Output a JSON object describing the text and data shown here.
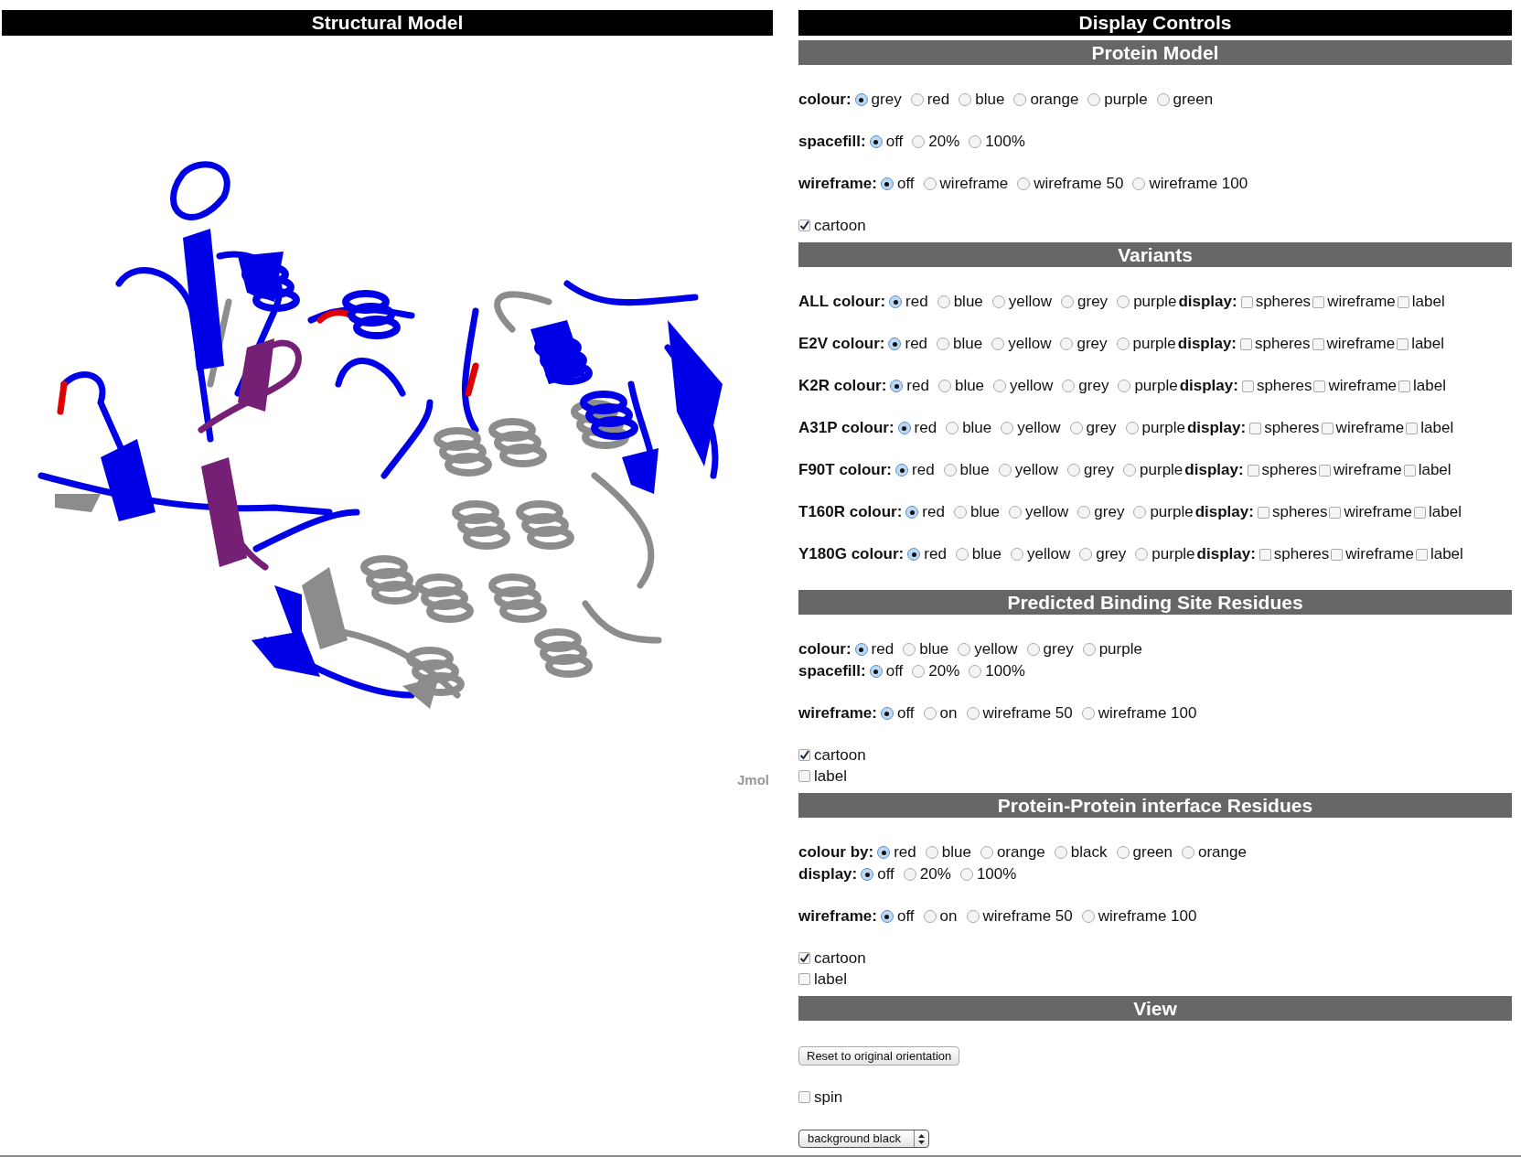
{
  "structural_model": {
    "title": "Structural Model",
    "viewer_label": "Jmol"
  },
  "display_controls": {
    "title": "Display Controls",
    "sections": [
      {
        "title": "Protein Model",
        "groups": [
          [
            {
              "kind": "radio",
              "label": "colour:",
              "options": [
                {
                  "text": "grey",
                  "selected": true
                },
                {
                  "text": "red",
                  "selected": false
                },
                {
                  "text": "blue",
                  "selected": false
                },
                {
                  "text": "orange",
                  "selected": false
                },
                {
                  "text": "purple",
                  "selected": false
                },
                {
                  "text": "green",
                  "selected": false
                }
              ]
            }
          ],
          [
            {
              "kind": "radio",
              "label": "spacefill:",
              "options": [
                {
                  "text": "off",
                  "selected": true
                },
                {
                  "text": "20%",
                  "selected": false
                },
                {
                  "text": "100%",
                  "selected": false
                }
              ]
            }
          ],
          [
            {
              "kind": "radio",
              "label": "wireframe:",
              "options": [
                {
                  "text": "off",
                  "selected": true
                },
                {
                  "text": "wireframe",
                  "selected": false
                },
                {
                  "text": "wireframe 50",
                  "selected": false
                },
                {
                  "text": "wireframe 100",
                  "selected": false
                }
              ]
            }
          ],
          [
            {
              "kind": "checkbox",
              "text": "cartoon",
              "checked": true
            }
          ]
        ]
      },
      {
        "title": "Variants",
        "groups": [
          [
            {
              "kind": "variant",
              "label": "ALL colour:",
              "options": [
                {
                  "text": "red",
                  "selected": true
                },
                {
                  "text": "blue",
                  "selected": false
                },
                {
                  "text": "yellow",
                  "selected": false
                },
                {
                  "text": "grey",
                  "selected": false
                },
                {
                  "text": "purple",
                  "selected": false
                }
              ],
              "display_label": "display:",
              "display_options": [
                {
                  "text": "spheres",
                  "checked": false
                },
                {
                  "text": "wireframe",
                  "checked": false
                },
                {
                  "text": "label",
                  "checked": false
                }
              ]
            }
          ],
          [
            {
              "kind": "variant",
              "label": "E2V colour:",
              "options": [
                {
                  "text": "red",
                  "selected": true
                },
                {
                  "text": "blue",
                  "selected": false
                },
                {
                  "text": "yellow",
                  "selected": false
                },
                {
                  "text": "grey",
                  "selected": false
                },
                {
                  "text": "purple",
                  "selected": false
                }
              ],
              "display_label": "display:",
              "display_options": [
                {
                  "text": "spheres",
                  "checked": false
                },
                {
                  "text": "wireframe",
                  "checked": false
                },
                {
                  "text": "label",
                  "checked": false
                }
              ]
            }
          ],
          [
            {
              "kind": "variant",
              "label": "K2R colour:",
              "options": [
                {
                  "text": "red",
                  "selected": true
                },
                {
                  "text": "blue",
                  "selected": false
                },
                {
                  "text": "yellow",
                  "selected": false
                },
                {
                  "text": "grey",
                  "selected": false
                },
                {
                  "text": "purple",
                  "selected": false
                }
              ],
              "display_label": "display:",
              "display_options": [
                {
                  "text": "spheres",
                  "checked": false
                },
                {
                  "text": "wireframe",
                  "checked": false
                },
                {
                  "text": "label",
                  "checked": false
                }
              ]
            }
          ],
          [
            {
              "kind": "variant",
              "label": "A31P colour:",
              "options": [
                {
                  "text": "red",
                  "selected": true
                },
                {
                  "text": "blue",
                  "selected": false
                },
                {
                  "text": "yellow",
                  "selected": false
                },
                {
                  "text": "grey",
                  "selected": false
                },
                {
                  "text": "purple",
                  "selected": false
                }
              ],
              "display_label": "display:",
              "display_options": [
                {
                  "text": "spheres",
                  "checked": false
                },
                {
                  "text": "wireframe",
                  "checked": false
                },
                {
                  "text": "label",
                  "checked": false
                }
              ]
            }
          ],
          [
            {
              "kind": "variant",
              "label": "F90T colour:",
              "options": [
                {
                  "text": "red",
                  "selected": true
                },
                {
                  "text": "blue",
                  "selected": false
                },
                {
                  "text": "yellow",
                  "selected": false
                },
                {
                  "text": "grey",
                  "selected": false
                },
                {
                  "text": "purple",
                  "selected": false
                }
              ],
              "display_label": "display:",
              "display_options": [
                {
                  "text": "spheres",
                  "checked": false
                },
                {
                  "text": "wireframe",
                  "checked": false
                },
                {
                  "text": "label",
                  "checked": false
                }
              ]
            }
          ],
          [
            {
              "kind": "variant",
              "label": "T160R colour:",
              "options": [
                {
                  "text": "red",
                  "selected": true
                },
                {
                  "text": "blue",
                  "selected": false
                },
                {
                  "text": "yellow",
                  "selected": false
                },
                {
                  "text": "grey",
                  "selected": false
                },
                {
                  "text": "purple",
                  "selected": false
                }
              ],
              "display_label": "display:",
              "display_options": [
                {
                  "text": "spheres",
                  "checked": false
                },
                {
                  "text": "wireframe",
                  "checked": false
                },
                {
                  "text": "label",
                  "checked": false
                }
              ]
            }
          ],
          [
            {
              "kind": "variant",
              "label": "Y180G colour:",
              "options": [
                {
                  "text": "red",
                  "selected": true
                },
                {
                  "text": "blue",
                  "selected": false
                },
                {
                  "text": "yellow",
                  "selected": false
                },
                {
                  "text": "grey",
                  "selected": false
                },
                {
                  "text": "purple",
                  "selected": false
                }
              ],
              "display_label": "display:",
              "display_options": [
                {
                  "text": "spheres",
                  "checked": false
                },
                {
                  "text": "wireframe",
                  "checked": false
                },
                {
                  "text": "label",
                  "checked": false
                }
              ]
            }
          ]
        ]
      },
      {
        "title": "Predicted Binding Site Residues",
        "groups": [
          [
            {
              "kind": "radio",
              "label": "colour:",
              "options": [
                {
                  "text": "red",
                  "selected": true
                },
                {
                  "text": "blue",
                  "selected": false
                },
                {
                  "text": "yellow",
                  "selected": false
                },
                {
                  "text": "grey",
                  "selected": false
                },
                {
                  "text": "purple",
                  "selected": false
                }
              ]
            },
            {
              "kind": "radio",
              "label": "spacefill:",
              "options": [
                {
                  "text": "off",
                  "selected": true
                },
                {
                  "text": "20%",
                  "selected": false
                },
                {
                  "text": "100%",
                  "selected": false
                }
              ]
            }
          ],
          [
            {
              "kind": "radio",
              "label": "wireframe:",
              "options": [
                {
                  "text": "off",
                  "selected": true
                },
                {
                  "text": "on",
                  "selected": false
                },
                {
                  "text": "wireframe 50",
                  "selected": false
                },
                {
                  "text": "wireframe 100",
                  "selected": false
                }
              ]
            }
          ],
          [
            {
              "kind": "checkbox",
              "text": "cartoon",
              "checked": true
            },
            {
              "kind": "checkbox",
              "text": "label",
              "checked": false
            }
          ]
        ]
      },
      {
        "title": "Protein-Protein interface Residues",
        "groups": [
          [
            {
              "kind": "radio",
              "label": "colour by:",
              "options": [
                {
                  "text": "red",
                  "selected": true
                },
                {
                  "text": "blue",
                  "selected": false
                },
                {
                  "text": "orange",
                  "selected": false
                },
                {
                  "text": "black",
                  "selected": false
                },
                {
                  "text": "green",
                  "selected": false
                },
                {
                  "text": "orange",
                  "selected": false
                }
              ]
            },
            {
              "kind": "radio",
              "label": "display:",
              "options": [
                {
                  "text": "off",
                  "selected": true
                },
                {
                  "text": "20%",
                  "selected": false
                },
                {
                  "text": "100%",
                  "selected": false
                }
              ]
            }
          ],
          [
            {
              "kind": "radio",
              "label": "wireframe:",
              "options": [
                {
                  "text": "off",
                  "selected": true
                },
                {
                  "text": "on",
                  "selected": false
                },
                {
                  "text": "wireframe 50",
                  "selected": false
                },
                {
                  "text": "wireframe 100",
                  "selected": false
                }
              ]
            }
          ],
          [
            {
              "kind": "checkbox",
              "text": "cartoon",
              "checked": true
            },
            {
              "kind": "checkbox",
              "text": "label",
              "checked": false
            }
          ]
        ]
      },
      {
        "title": "View",
        "groups": [
          [
            {
              "kind": "button",
              "text": "Reset to original orientation"
            }
          ],
          [
            {
              "kind": "checkbox",
              "text": "spin",
              "checked": false
            }
          ],
          [
            {
              "kind": "select",
              "value": "background black"
            }
          ]
        ]
      }
    ]
  }
}
